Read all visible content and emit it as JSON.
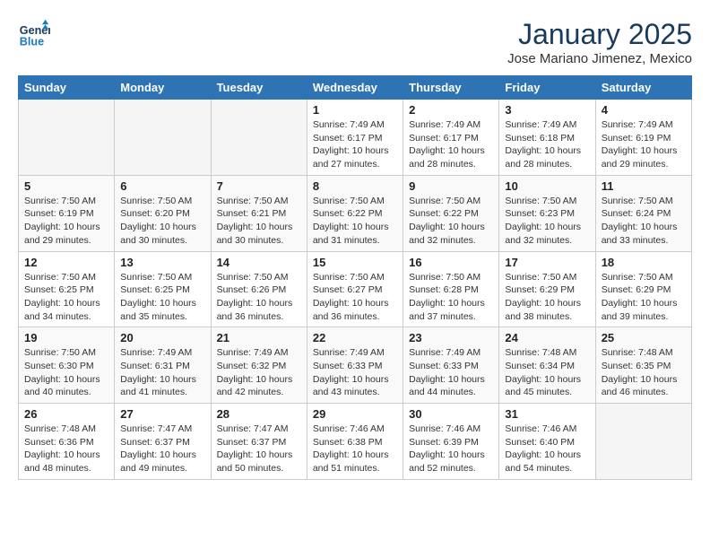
{
  "header": {
    "logo_line1": "General",
    "logo_line2": "Blue",
    "month": "January 2025",
    "location": "Jose Mariano Jimenez, Mexico"
  },
  "days_of_week": [
    "Sunday",
    "Monday",
    "Tuesday",
    "Wednesday",
    "Thursday",
    "Friday",
    "Saturday"
  ],
  "weeks": [
    [
      {
        "day": "",
        "info": ""
      },
      {
        "day": "",
        "info": ""
      },
      {
        "day": "",
        "info": ""
      },
      {
        "day": "1",
        "info": "Sunrise: 7:49 AM\nSunset: 6:17 PM\nDaylight: 10 hours\nand 27 minutes."
      },
      {
        "day": "2",
        "info": "Sunrise: 7:49 AM\nSunset: 6:17 PM\nDaylight: 10 hours\nand 28 minutes."
      },
      {
        "day": "3",
        "info": "Sunrise: 7:49 AM\nSunset: 6:18 PM\nDaylight: 10 hours\nand 28 minutes."
      },
      {
        "day": "4",
        "info": "Sunrise: 7:49 AM\nSunset: 6:19 PM\nDaylight: 10 hours\nand 29 minutes."
      }
    ],
    [
      {
        "day": "5",
        "info": "Sunrise: 7:50 AM\nSunset: 6:19 PM\nDaylight: 10 hours\nand 29 minutes."
      },
      {
        "day": "6",
        "info": "Sunrise: 7:50 AM\nSunset: 6:20 PM\nDaylight: 10 hours\nand 30 minutes."
      },
      {
        "day": "7",
        "info": "Sunrise: 7:50 AM\nSunset: 6:21 PM\nDaylight: 10 hours\nand 30 minutes."
      },
      {
        "day": "8",
        "info": "Sunrise: 7:50 AM\nSunset: 6:22 PM\nDaylight: 10 hours\nand 31 minutes."
      },
      {
        "day": "9",
        "info": "Sunrise: 7:50 AM\nSunset: 6:22 PM\nDaylight: 10 hours\nand 32 minutes."
      },
      {
        "day": "10",
        "info": "Sunrise: 7:50 AM\nSunset: 6:23 PM\nDaylight: 10 hours\nand 32 minutes."
      },
      {
        "day": "11",
        "info": "Sunrise: 7:50 AM\nSunset: 6:24 PM\nDaylight: 10 hours\nand 33 minutes."
      }
    ],
    [
      {
        "day": "12",
        "info": "Sunrise: 7:50 AM\nSunset: 6:25 PM\nDaylight: 10 hours\nand 34 minutes."
      },
      {
        "day": "13",
        "info": "Sunrise: 7:50 AM\nSunset: 6:25 PM\nDaylight: 10 hours\nand 35 minutes."
      },
      {
        "day": "14",
        "info": "Sunrise: 7:50 AM\nSunset: 6:26 PM\nDaylight: 10 hours\nand 36 minutes."
      },
      {
        "day": "15",
        "info": "Sunrise: 7:50 AM\nSunset: 6:27 PM\nDaylight: 10 hours\nand 36 minutes."
      },
      {
        "day": "16",
        "info": "Sunrise: 7:50 AM\nSunset: 6:28 PM\nDaylight: 10 hours\nand 37 minutes."
      },
      {
        "day": "17",
        "info": "Sunrise: 7:50 AM\nSunset: 6:29 PM\nDaylight: 10 hours\nand 38 minutes."
      },
      {
        "day": "18",
        "info": "Sunrise: 7:50 AM\nSunset: 6:29 PM\nDaylight: 10 hours\nand 39 minutes."
      }
    ],
    [
      {
        "day": "19",
        "info": "Sunrise: 7:50 AM\nSunset: 6:30 PM\nDaylight: 10 hours\nand 40 minutes."
      },
      {
        "day": "20",
        "info": "Sunrise: 7:49 AM\nSunset: 6:31 PM\nDaylight: 10 hours\nand 41 minutes."
      },
      {
        "day": "21",
        "info": "Sunrise: 7:49 AM\nSunset: 6:32 PM\nDaylight: 10 hours\nand 42 minutes."
      },
      {
        "day": "22",
        "info": "Sunrise: 7:49 AM\nSunset: 6:33 PM\nDaylight: 10 hours\nand 43 minutes."
      },
      {
        "day": "23",
        "info": "Sunrise: 7:49 AM\nSunset: 6:33 PM\nDaylight: 10 hours\nand 44 minutes."
      },
      {
        "day": "24",
        "info": "Sunrise: 7:48 AM\nSunset: 6:34 PM\nDaylight: 10 hours\nand 45 minutes."
      },
      {
        "day": "25",
        "info": "Sunrise: 7:48 AM\nSunset: 6:35 PM\nDaylight: 10 hours\nand 46 minutes."
      }
    ],
    [
      {
        "day": "26",
        "info": "Sunrise: 7:48 AM\nSunset: 6:36 PM\nDaylight: 10 hours\nand 48 minutes."
      },
      {
        "day": "27",
        "info": "Sunrise: 7:47 AM\nSunset: 6:37 PM\nDaylight: 10 hours\nand 49 minutes."
      },
      {
        "day": "28",
        "info": "Sunrise: 7:47 AM\nSunset: 6:37 PM\nDaylight: 10 hours\nand 50 minutes."
      },
      {
        "day": "29",
        "info": "Sunrise: 7:46 AM\nSunset: 6:38 PM\nDaylight: 10 hours\nand 51 minutes."
      },
      {
        "day": "30",
        "info": "Sunrise: 7:46 AM\nSunset: 6:39 PM\nDaylight: 10 hours\nand 52 minutes."
      },
      {
        "day": "31",
        "info": "Sunrise: 7:46 AM\nSunset: 6:40 PM\nDaylight: 10 hours\nand 54 minutes."
      },
      {
        "day": "",
        "info": ""
      }
    ]
  ]
}
